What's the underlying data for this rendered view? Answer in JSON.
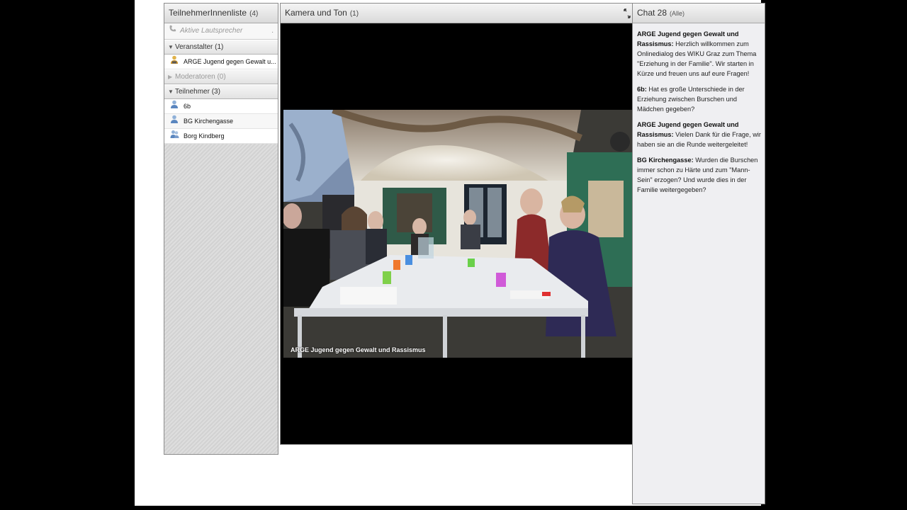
{
  "people_pod": {
    "title": "TeilnehmerInnenliste",
    "count": "(4)",
    "audio_row": "Aktive Lautsprecher",
    "groups": {
      "hosts": {
        "label": "Veranstalter (1)",
        "members": [
          "ARGE Jugend gegen Gewalt u..."
        ]
      },
      "presenters": {
        "label": "Moderatoren (0)"
      },
      "participants": {
        "label": "Teilnehmer (3)",
        "members": [
          "6b",
          "BG Kirchengasse",
          "Borg Kindberg"
        ]
      }
    }
  },
  "camera_pod": {
    "title": "Kamera und Ton",
    "count": "(1)",
    "video_caption": "ARGE Jugend gegen Gewalt und Rassismus"
  },
  "chat_pod": {
    "title": "Chat 28",
    "scope": "(Alle)",
    "messages": [
      {
        "sender": "ARGE Jugend gegen Gewalt und Rassismus:",
        "text": "Herzlich willkommen zum Onlinedialog des WIKU Graz zum Thema \"Erziehung in der Familie\". Wir starten in Kürze und freuen uns auf eure Fragen!"
      },
      {
        "sender": "6b:",
        "text": "Hat es große Unterschiede in der Erziehung zwischen Burschen und Mädchen gegeben?"
      },
      {
        "sender": "ARGE Jugend gegen Gewalt und Rassismus:",
        "text": "Vielen Dank für die Frage, wir haben sie an die Runde weitergeleitet!"
      },
      {
        "sender": "BG Kirchengasse:",
        "text": "Wurden die Burschen immer schon zu Härte und zum \"Mann-Sein\" erzogen? Und wurde dies in der Familie weitergegeben?"
      }
    ]
  },
  "colors": {
    "page_bg": "#000000",
    "stage_bg": "#ffffff",
    "chat_bg": "#efeff2",
    "header_grad_top": "#f4f4f4",
    "header_grad_bottom": "#dadada"
  }
}
